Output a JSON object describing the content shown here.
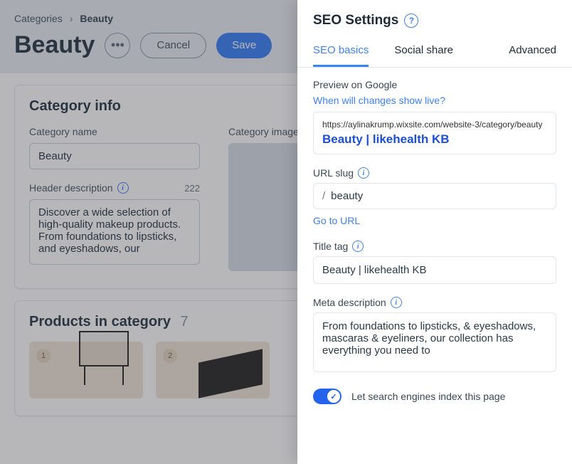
{
  "breadcrumb": {
    "root": "Categories",
    "current": "Beauty"
  },
  "page": {
    "title": "Beauty",
    "cancel": "Cancel",
    "save": "Save"
  },
  "category_info": {
    "heading": "Category info",
    "name_label": "Category name",
    "name_value": "Beauty",
    "desc_label": "Header description",
    "desc_count": "222",
    "desc_value": "Discover a wide selection of high-quality makeup products. From foundations to lipsticks, and eyeshadows, our",
    "image_label": "Category image"
  },
  "products": {
    "heading": "Products in category",
    "count": "7",
    "items": [
      {
        "num": "1"
      },
      {
        "num": "2"
      }
    ]
  },
  "panel": {
    "title": "SEO Settings",
    "tabs": {
      "basics": "SEO basics",
      "social": "Social share",
      "advanced": "Advanced"
    },
    "preview_label": "Preview on Google",
    "preview_link": "When will changes show live?",
    "preview_url": "https://aylinakrump.wixsite.com/website-3/category/beauty",
    "preview_title": "Beauty | likehealth KB",
    "slug_label": "URL slug",
    "slug_prefix": "/",
    "slug_value": "beauty",
    "goto_url": "Go to URL",
    "title_label": "Title tag",
    "title_value": "Beauty | likehealth KB",
    "meta_label": "Meta description",
    "meta_value": "From foundations to lipsticks, & eyeshadows, mascaras & eyeliners, our collection has everything you need to",
    "index_label": "Let search engines index this page"
  }
}
